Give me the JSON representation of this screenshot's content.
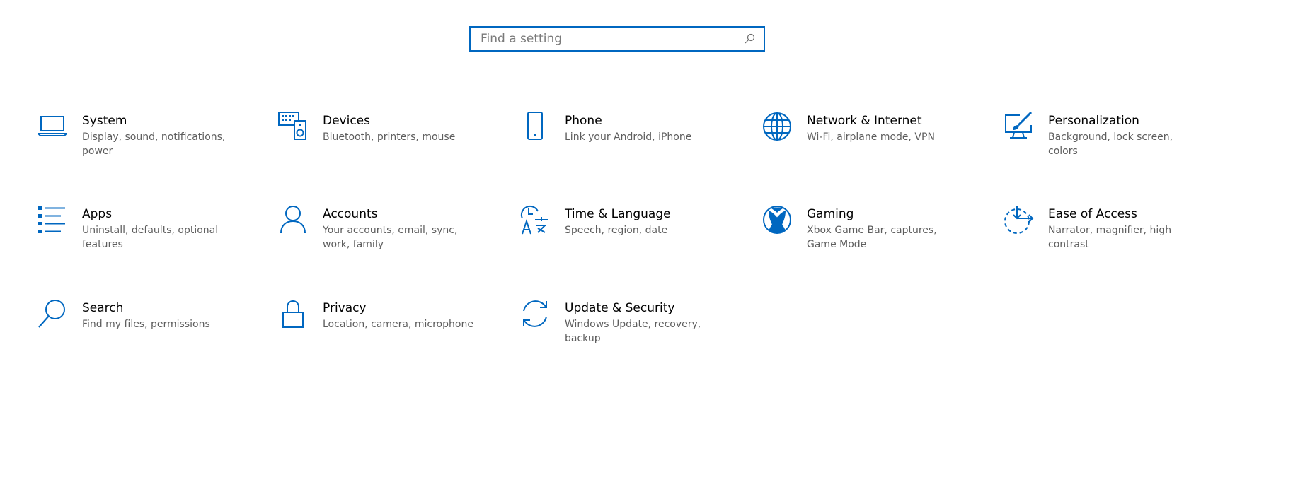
{
  "search": {
    "placeholder": "Find a setting",
    "value": ""
  },
  "accent_color": "#0067c0",
  "tiles": [
    {
      "title": "System",
      "desc": "Display, sound, notifications, power",
      "icon": "laptop-icon"
    },
    {
      "title": "Devices",
      "desc": "Bluetooth, printers, mouse",
      "icon": "devices-icon"
    },
    {
      "title": "Phone",
      "desc": "Link your Android, iPhone",
      "icon": "phone-icon"
    },
    {
      "title": "Network & Internet",
      "desc": "Wi-Fi, airplane mode, VPN",
      "icon": "globe-icon"
    },
    {
      "title": "Personalization",
      "desc": "Background, lock screen, colors",
      "icon": "paint-brush-icon"
    },
    {
      "title": "Apps",
      "desc": "Uninstall, defaults, optional features",
      "icon": "apps-list-icon"
    },
    {
      "title": "Accounts",
      "desc": "Your accounts, email, sync, work, family",
      "icon": "person-icon"
    },
    {
      "title": "Time & Language",
      "desc": "Speech, region, date",
      "icon": "time-language-icon"
    },
    {
      "title": "Gaming",
      "desc": "Xbox Game Bar, captures, Game Mode",
      "icon": "xbox-icon"
    },
    {
      "title": "Ease of Access",
      "desc": "Narrator, magnifier, high contrast",
      "icon": "ease-of-access-icon"
    },
    {
      "title": "Search",
      "desc": "Find my files, permissions",
      "icon": "magnifier-icon"
    },
    {
      "title": "Privacy",
      "desc": "Location, camera, microphone",
      "icon": "lock-icon"
    },
    {
      "title": "Update & Security",
      "desc": "Windows Update, recovery, backup",
      "icon": "sync-arrows-icon"
    }
  ]
}
